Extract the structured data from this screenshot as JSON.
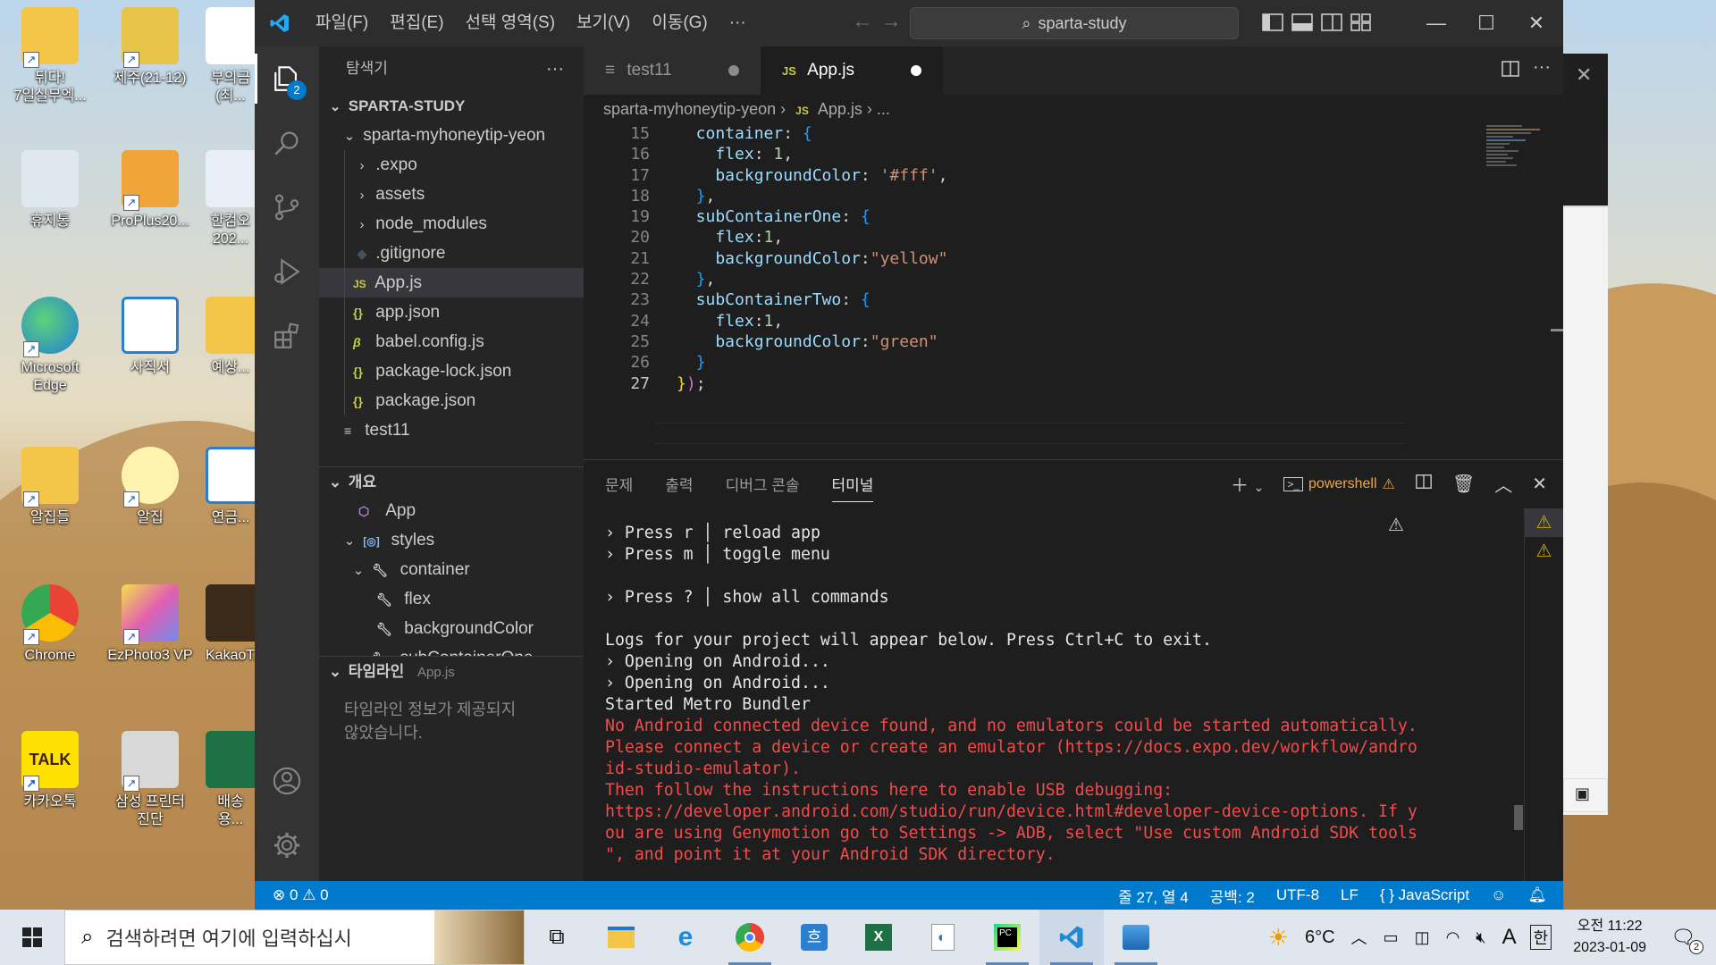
{
  "desktop": {
    "icons": [
      {
        "label": "뒤다!\n7일실무엑..."
      },
      {
        "label": "제주(21-12)"
      },
      {
        "label": "부의금\n(최..."
      },
      {
        "label": "휴지통"
      },
      {
        "label": "ProPlus20..."
      },
      {
        "label": "한컴오\n202..."
      },
      {
        "label": "Microsoft\nEdge"
      },
      {
        "label": "사직서"
      },
      {
        "label": "예상..."
      },
      {
        "label": "알집들"
      },
      {
        "label": "알집"
      },
      {
        "label": "연금..."
      },
      {
        "label": "Chrome"
      },
      {
        "label": "EzPhoto3 VP"
      },
      {
        "label": "KakaoT..."
      },
      {
        "label": "카카오톡"
      },
      {
        "label": "삼성 프린터\n진단"
      },
      {
        "label": "배송용..."
      }
    ]
  },
  "titlebar": {
    "menus": [
      "파일(F)",
      "편집(E)",
      "선택 영역(S)",
      "보기(V)",
      "이동(G)",
      "···"
    ],
    "search": "sparta-study"
  },
  "activity": {
    "explorer_badge": "2"
  },
  "sidebar": {
    "explorer_title": "탐색기",
    "workspace": "SPARTA-STUDY",
    "project": "sparta-myhoneytip-yeon",
    "files": [
      {
        "name": ".expo",
        "icon": "›"
      },
      {
        "name": "assets",
        "icon": "›"
      },
      {
        "name": "node_modules",
        "icon": "›"
      },
      {
        "name": ".gitignore",
        "icon": "◆"
      },
      {
        "name": "App.js",
        "icon": "JS"
      },
      {
        "name": "app.json",
        "icon": "{}"
      },
      {
        "name": "babel.config.js",
        "icon": "β"
      },
      {
        "name": "package-lock.json",
        "icon": "{}"
      },
      {
        "name": "package.json",
        "icon": "{}"
      }
    ],
    "test_file": "test11",
    "outline_title": "개요",
    "outline": [
      "App",
      "styles",
      "container",
      "flex",
      "backgroundColor",
      "subContainerOne"
    ],
    "timeline_title": "타임라인",
    "timeline_file": "App.js",
    "timeline_msg": "타임라인 정보가 제공되지\n않았습니다."
  },
  "editor": {
    "tabs": [
      {
        "label": "test11"
      },
      {
        "label": "App.js",
        "prefix": "JS"
      }
    ],
    "breadcrumb": {
      "folder": "sparta-myhoneytip-yeon",
      "sep": "›",
      "icon": "JS",
      "file": "App.js",
      "tail": "› ..."
    },
    "lines": [
      {
        "n": "15",
        "t": "  container: {"
      },
      {
        "n": "16",
        "t": "    flex: 1,"
      },
      {
        "n": "17",
        "t": "    backgroundColor: '#fff',"
      },
      {
        "n": "18",
        "t": "  },"
      },
      {
        "n": "19",
        "t": "  subContainerOne: {"
      },
      {
        "n": "20",
        "t": "    flex:1,"
      },
      {
        "n": "21",
        "t": "    backgroundColor:\"yellow\""
      },
      {
        "n": "22",
        "t": "  },"
      },
      {
        "n": "23",
        "t": "  subContainerTwo: {"
      },
      {
        "n": "24",
        "t": "    flex:1,"
      },
      {
        "n": "25",
        "t": "    backgroundColor:\"green\""
      },
      {
        "n": "26",
        "t": "  }"
      },
      {
        "n": "27",
        "t": "});"
      }
    ]
  },
  "panel": {
    "tabs": [
      "문제",
      "출력",
      "디버그 콘솔",
      "터미널"
    ],
    "shell": "powershell",
    "terminal": [
      {
        "t": "› Press r │ reload app",
        "err": false
      },
      {
        "t": "› Press m │ toggle menu",
        "err": false
      },
      {
        "t": "",
        "err": false
      },
      {
        "t": "› Press ? │ show all commands",
        "err": false
      },
      {
        "t": "",
        "err": false
      },
      {
        "t": "Logs for your project will appear below. Press Ctrl+C to exit.",
        "err": false
      },
      {
        "t": "› Opening on Android...",
        "err": false
      },
      {
        "t": "› Opening on Android...",
        "err": false
      },
      {
        "t": "Started Metro Bundler",
        "err": false
      },
      {
        "t": "No Android connected device found, and no emulators could be started automatically.",
        "err": true
      },
      {
        "t": "Please connect a device or create an emulator (https://docs.expo.dev/workflow/andro",
        "err": true
      },
      {
        "t": "id-studio-emulator).",
        "err": true
      },
      {
        "t": "Then follow the instructions here to enable USB debugging:",
        "err": true
      },
      {
        "t": "https://developer.android.com/studio/run/device.html#developer-device-options. If y",
        "err": true
      },
      {
        "t": "ou are using Genymotion go to Settings -> ADB, select \"Use custom Android SDK tools",
        "err": true
      },
      {
        "t": "\", and point it at your Android SDK directory.",
        "err": true
      }
    ]
  },
  "statusbar": {
    "errors": "0",
    "warnings": "0",
    "position": "줄 27, 열 4",
    "spaces": "공백: 2",
    "encoding": "UTF-8",
    "eol": "LF",
    "language": "{ } JavaScript"
  },
  "taskbar": {
    "search_placeholder": "검색하려면 여기에 입력하십시",
    "weather": "6°C",
    "ime": "A",
    "lang": "한",
    "time": "오전 11:22",
    "date": "2023-01-09",
    "notif_count": "2"
  },
  "colors": {
    "accent": "#007acc",
    "error": "#f14c4c",
    "warning": "#cca700",
    "modified_dot": "#ffffff"
  }
}
